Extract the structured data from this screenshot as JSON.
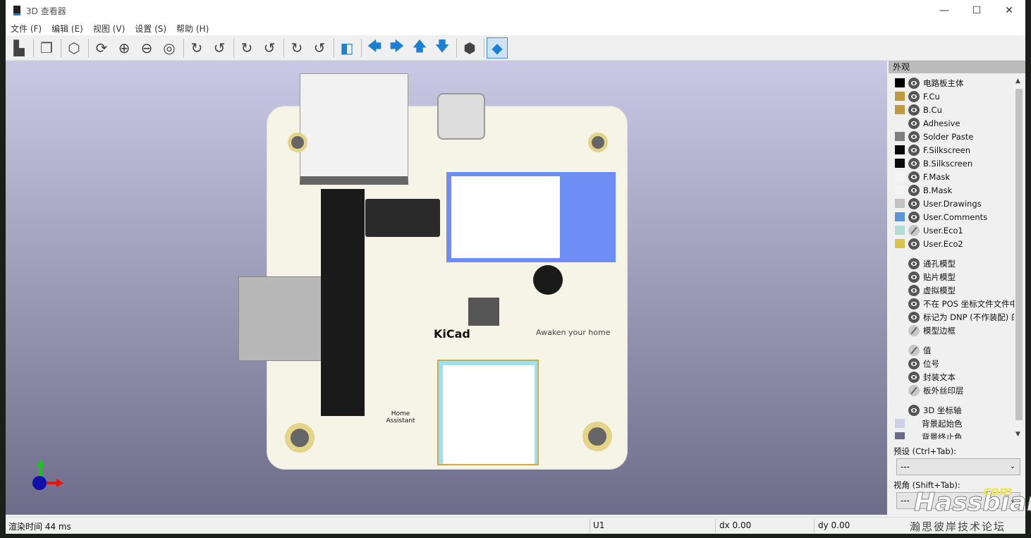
{
  "window": {
    "title": "3D 查看器",
    "controls": [
      "minimize",
      "maximize",
      "close"
    ]
  },
  "menu": [
    "文件 (F)",
    "编辑 (E)",
    "视图 (V)",
    "设置 (S)",
    "帮助 (H)"
  ],
  "toolbar": [
    {
      "icon": "export-image-icon"
    },
    {
      "sep": true
    },
    {
      "icon": "copy-icon"
    },
    {
      "sep": true
    },
    {
      "icon": "raytrace-cube-icon"
    },
    {
      "sep": true
    },
    {
      "icon": "reload-icon"
    },
    {
      "icon": "zoom-in-icon"
    },
    {
      "icon": "zoom-out-icon"
    },
    {
      "icon": "zoom-fit-icon"
    },
    {
      "sep": true
    },
    {
      "icon": "rotate-x-cw-icon"
    },
    {
      "icon": "rotate-x-ccw-icon"
    },
    {
      "sep": true
    },
    {
      "icon": "rotate-y-cw-icon"
    },
    {
      "icon": "rotate-y-ccw-icon"
    },
    {
      "sep": true
    },
    {
      "icon": "rotate-z-cw-icon"
    },
    {
      "icon": "rotate-z-ccw-icon"
    },
    {
      "sep": true
    },
    {
      "icon": "flip-board-icon"
    },
    {
      "sep": true
    },
    {
      "icon": "arrow-left-icon"
    },
    {
      "icon": "arrow-right-icon"
    },
    {
      "icon": "arrow-up-icon"
    },
    {
      "icon": "arrow-down-icon"
    },
    {
      "sep": true
    },
    {
      "icon": "orthographic-cube-icon"
    },
    {
      "sep": true
    },
    {
      "icon": "appearance-layers-icon",
      "active": true
    }
  ],
  "panel": {
    "title": "外观",
    "layers": [
      {
        "label": "电路板主体",
        "color": "#000000",
        "visible": true
      },
      {
        "label": "F.Cu",
        "color": "#c09a3e",
        "visible": true
      },
      {
        "label": "B.Cu",
        "color": "#c09a3e",
        "visible": true
      },
      {
        "label": "Adhesive",
        "color": "",
        "visible": true
      },
      {
        "label": "Solder Paste",
        "color": "#808080",
        "visible": true
      },
      {
        "label": "F.Silkscreen",
        "color": "#0a0a0a",
        "visible": true
      },
      {
        "label": "B.Silkscreen",
        "color": "#0a0a0a",
        "visible": true
      },
      {
        "label": "F.Mask",
        "color": "#f4f4f4",
        "visible": true
      },
      {
        "label": "B.Mask",
        "color": "#f4f4f4",
        "visible": true
      },
      {
        "label": "User.Drawings",
        "color": "#c2c2c2",
        "visible": true
      },
      {
        "label": "User.Comments",
        "color": "#5b95dc",
        "visible": true
      },
      {
        "label": "User.Eco1",
        "color": "#b3dcd3",
        "visible": false
      },
      {
        "label": "User.Eco2",
        "color": "#d8c44d",
        "visible": true
      },
      {
        "gap": true
      },
      {
        "label": "通孔模型",
        "visible": true
      },
      {
        "label": "贴片模型",
        "visible": true
      },
      {
        "label": "虚拟模型",
        "visible": true
      },
      {
        "label": "不在 POS 坐标文件文件中的",
        "visible": true
      },
      {
        "label": "标记为 DNP (不作装配) 的",
        "visible": true
      },
      {
        "label": "模型边框",
        "visible": false
      },
      {
        "gap": true
      },
      {
        "label": "值",
        "visible": false
      },
      {
        "label": "位号",
        "visible": true
      },
      {
        "label": "封装文本",
        "visible": true
      },
      {
        "label": "板外丝印层",
        "visible": false
      },
      {
        "gap": true
      },
      {
        "label": "3D 坐标轴",
        "visible": true
      },
      {
        "label": "背景起始色",
        "color": "#cfcfe8",
        "noeye": true
      },
      {
        "label": "背景终止色",
        "color": "#6a6a88",
        "noeye": true
      }
    ],
    "preset_label": "预设 (Ctrl+Tab):",
    "preset_value": "---",
    "view_label": "视角 (Shift+Tab):",
    "view_value": "---"
  },
  "status": {
    "render_time": "渲染时间 44 ms",
    "selection": "U1",
    "dx": "dx 0.00",
    "dy": "dy 0.00"
  },
  "watermark": {
    "brand": "Hassbian",
    "suffix": "com",
    "forum": "瀚思彼岸技术论坛"
  },
  "pcb_labels": {
    "kicad": "KiCad",
    "ha": "Home Assistant",
    "tagline": "Awaken your home"
  }
}
